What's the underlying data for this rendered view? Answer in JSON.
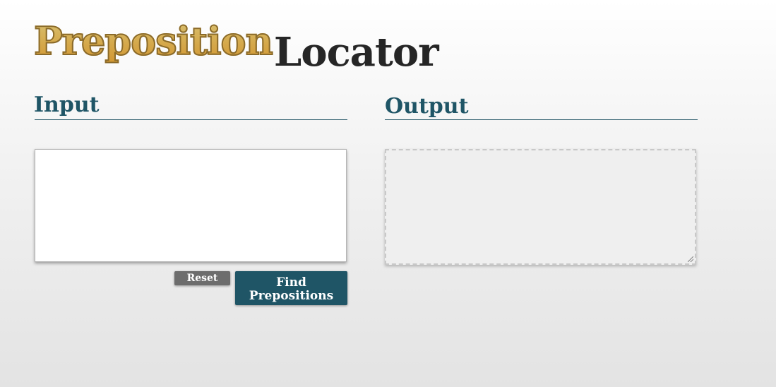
{
  "logo": {
    "part1": "Preposition",
    "part2": "Locator"
  },
  "input_section": {
    "title": "Input",
    "value": "",
    "placeholder": ""
  },
  "output_section": {
    "title": "Output",
    "value": ""
  },
  "buttons": {
    "reset_label": "Reset",
    "find_label": "Find\nPrepositions"
  },
  "colors": {
    "accent": "#1f5566",
    "logo_gold": "#fbc85a",
    "logo_dark": "#262626",
    "reset_gray": "#6d6d6d"
  }
}
